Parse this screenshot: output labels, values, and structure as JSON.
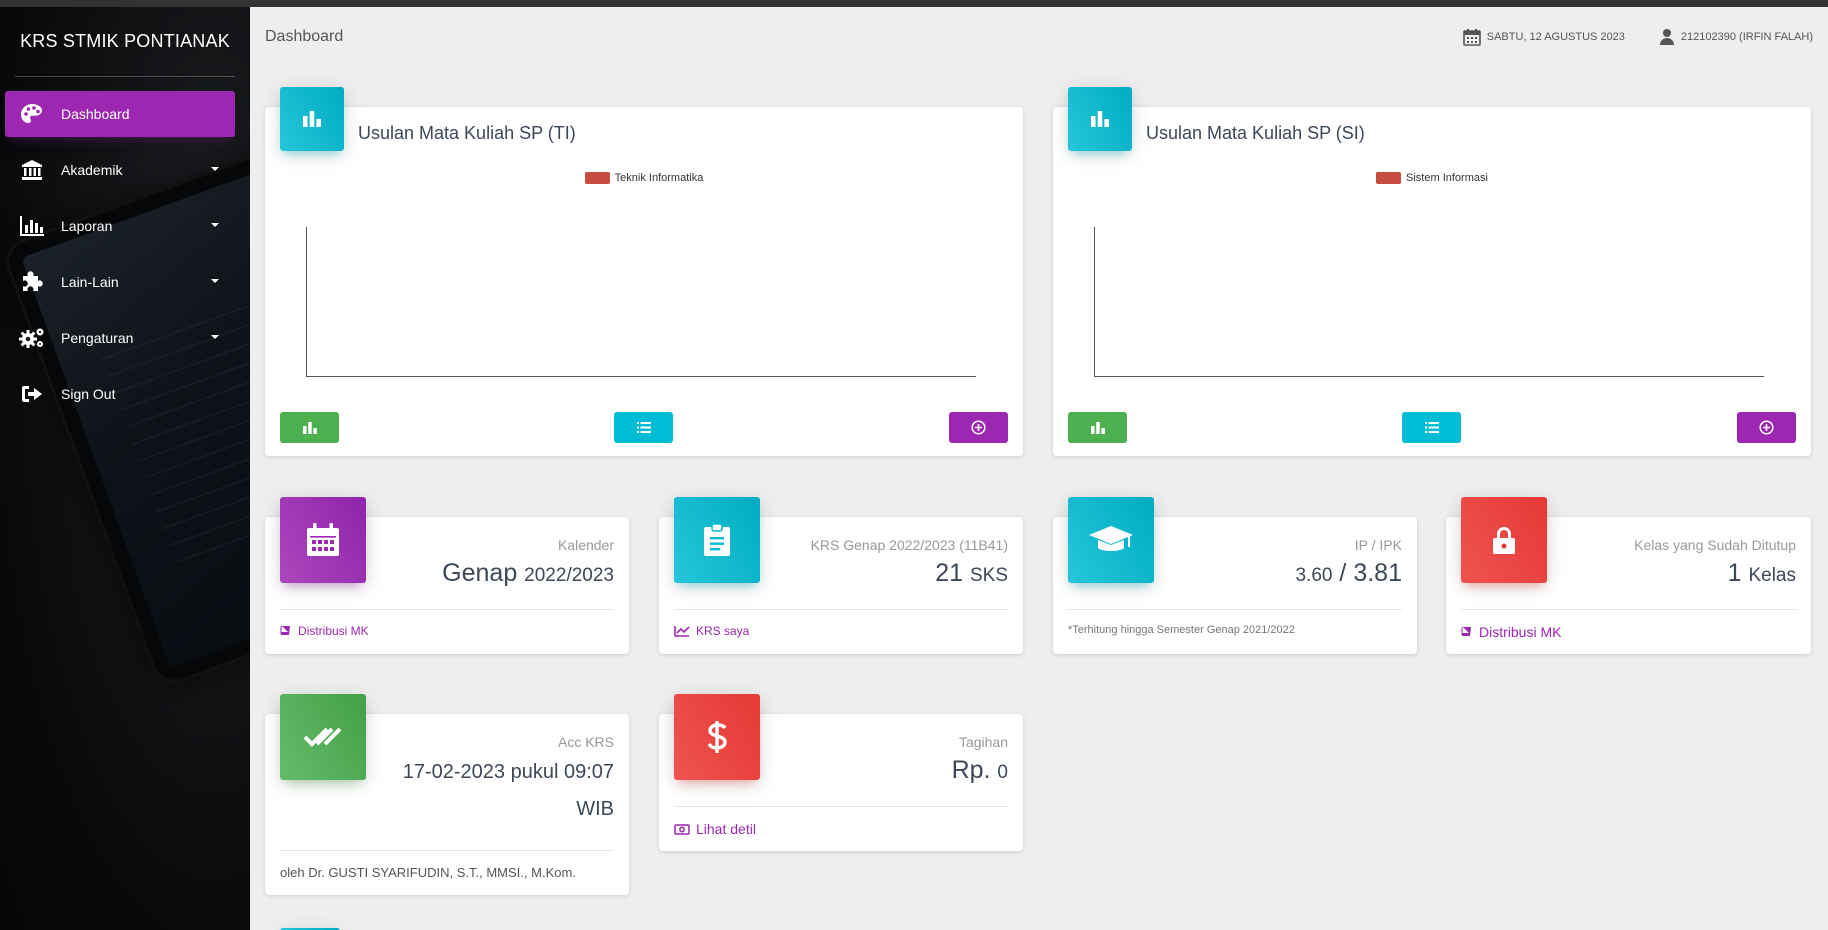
{
  "brand": "KRS STMIK PONTIANAK",
  "sidebar": {
    "items": [
      {
        "label": "Dashboard",
        "icon": "palette-icon"
      },
      {
        "label": "Akademik",
        "icon": "institution-icon"
      },
      {
        "label": "Laporan",
        "icon": "bar-chart-icon"
      },
      {
        "label": "Lain-Lain",
        "icon": "puzzle-icon"
      },
      {
        "label": "Pengaturan",
        "icon": "gears-icon"
      },
      {
        "label": "Sign Out",
        "icon": "sign-out-icon"
      }
    ]
  },
  "navbar": {
    "title": "Dashboard",
    "date": "SABTU, 12 AGUSTUS 2023",
    "user": "212102390 (IRFIN FALAH)"
  },
  "charts": [
    {
      "title": "Usulan Mata Kuliah SP (TI)",
      "legend": "Teknik Informatika"
    },
    {
      "title": "Usulan Mata Kuliah SP (SI)",
      "legend": "Sistem Informasi"
    }
  ],
  "chart_data": [
    {
      "type": "bar",
      "title": "Usulan Mata Kuliah SP (TI)",
      "series": [
        {
          "name": "Teknik Informatika",
          "values": []
        }
      ],
      "categories": []
    },
    {
      "type": "bar",
      "title": "Usulan Mata Kuliah SP (SI)",
      "series": [
        {
          "name": "Sistem Informasi",
          "values": []
        }
      ],
      "categories": []
    }
  ],
  "stats": {
    "kalender": {
      "category": "Kalender",
      "value": "Genap",
      "sub": "2022/2023",
      "footer": "Distribusi MK"
    },
    "krs": {
      "category": "KRS Genap 2022/2023 (11B41)",
      "value": "21",
      "sub": "SKS",
      "footer": "KRS saya"
    },
    "ip": {
      "category": "IP / IPK",
      "ip": "3.60",
      "sep": "/",
      "ipk": "3.81",
      "footer": "*Terhitung hingga Semester Genap 2021/2022"
    },
    "kelas": {
      "category": "Kelas yang Sudah Ditutup",
      "value": "1",
      "sub": "Kelas",
      "footer": "Distribusi MK"
    },
    "acc": {
      "category": "Acc KRS",
      "line1": "17-02-2023 pukul 09:07",
      "line2": "WIB",
      "footer": "oleh Dr. GUSTI SYARIFUDIN, S.T., MMSI., M.Kom."
    },
    "tagihan": {
      "category": "Tagihan",
      "value": "Rp.",
      "sub": "0",
      "footer": "Lihat detil"
    }
  },
  "colors": {
    "primary": "#9c27b0",
    "info": "#00bcd4",
    "success": "#4caf50",
    "danger": "#f44336"
  }
}
